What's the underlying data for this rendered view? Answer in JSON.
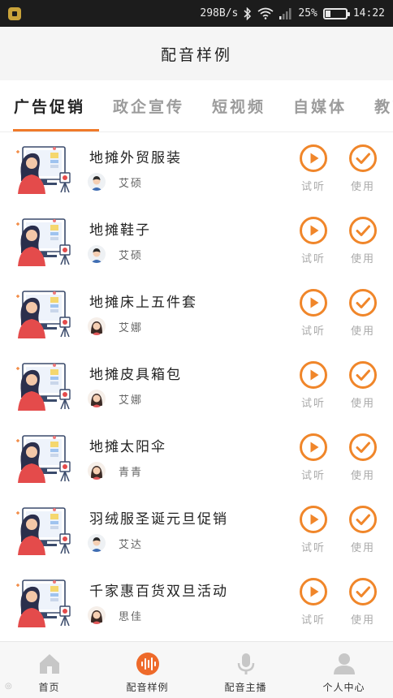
{
  "status_bar": {
    "net_speed": "298B/s",
    "battery": "25%",
    "battery_level": 0.25,
    "time": "14:22"
  },
  "header": {
    "title": "配音样例"
  },
  "tabs": [
    {
      "label": "广告促销",
      "active": true
    },
    {
      "label": "政企宣传",
      "active": false
    },
    {
      "label": "短视频",
      "active": false
    },
    {
      "label": "自媒体",
      "active": false
    },
    {
      "label": "教育",
      "active": false
    }
  ],
  "items": [
    {
      "title": "地摊外贸服装",
      "author": "艾硕",
      "avatar": "male"
    },
    {
      "title": "地摊鞋子",
      "author": "艾硕",
      "avatar": "male"
    },
    {
      "title": "地摊床上五件套",
      "author": "艾娜",
      "avatar": "female"
    },
    {
      "title": "地摊皮具箱包",
      "author": "艾娜",
      "avatar": "female"
    },
    {
      "title": "地摊太阳伞",
      "author": "青青",
      "avatar": "female"
    },
    {
      "title": "羽绒服圣诞元旦促销",
      "author": "艾达",
      "avatar": "male"
    },
    {
      "title": "千家惠百货双旦活动",
      "author": "思佳",
      "avatar": "female"
    }
  ],
  "actions": {
    "play_label": "试听",
    "use_label": "使用"
  },
  "bottom_nav": [
    {
      "label": "首页",
      "icon": "home-icon"
    },
    {
      "label": "配音样例",
      "icon": "waveform-icon"
    },
    {
      "label": "配音主播",
      "icon": "microphone-icon"
    },
    {
      "label": "个人中心",
      "icon": "user-icon"
    }
  ],
  "colors": {
    "accent": "#f0862a",
    "active_nav": "#ee6a2a"
  }
}
